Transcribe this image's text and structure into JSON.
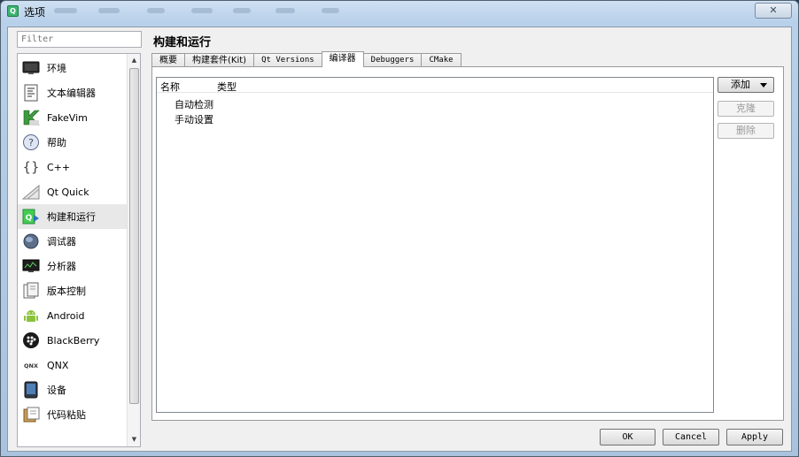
{
  "window": {
    "title": "选项",
    "close_label": "✕"
  },
  "filter": {
    "placeholder": "Filter"
  },
  "sidebar": {
    "items": [
      {
        "label": "环境",
        "icon": "monitor-icon"
      },
      {
        "label": "文本编辑器",
        "icon": "text-document-icon"
      },
      {
        "label": "FakeVim",
        "icon": "fakevim-icon"
      },
      {
        "label": "帮助",
        "icon": "help-icon"
      },
      {
        "label": "C++",
        "icon": "braces-icon"
      },
      {
        "label": "Qt Quick",
        "icon": "qt-quick-icon"
      },
      {
        "label": "构建和运行",
        "icon": "build-run-icon",
        "selected": true
      },
      {
        "label": "调试器",
        "icon": "debugger-icon"
      },
      {
        "label": "分析器",
        "icon": "analyzer-icon"
      },
      {
        "label": "版本控制",
        "icon": "version-control-icon"
      },
      {
        "label": "Android",
        "icon": "android-icon"
      },
      {
        "label": "BlackBerry",
        "icon": "blackberry-icon"
      },
      {
        "label": "QNX",
        "icon": "qnx-icon"
      },
      {
        "label": "设备",
        "icon": "device-icon"
      },
      {
        "label": "代码粘贴",
        "icon": "code-paste-icon"
      }
    ]
  },
  "page": {
    "title": "构建和运行"
  },
  "tabs": [
    {
      "label": "概要",
      "mono": false
    },
    {
      "label": "构建套件(Kit)",
      "mono": false
    },
    {
      "label": "Qt Versions",
      "mono": true
    },
    {
      "label": "编译器",
      "mono": false,
      "active": true
    },
    {
      "label": "Debuggers",
      "mono": true
    },
    {
      "label": "CMake",
      "mono": true
    }
  ],
  "compilers": {
    "columns": [
      "名称",
      "类型"
    ],
    "rows": [
      "自动检测",
      "手动设置"
    ],
    "add_label": "添加",
    "clone_label": "克隆",
    "remove_label": "删除"
  },
  "buttons": {
    "ok": "OK",
    "cancel": "Cancel",
    "apply": "Apply"
  },
  "colors": {
    "qt_green": "#41cd52",
    "selection": "#e8e8e8"
  }
}
